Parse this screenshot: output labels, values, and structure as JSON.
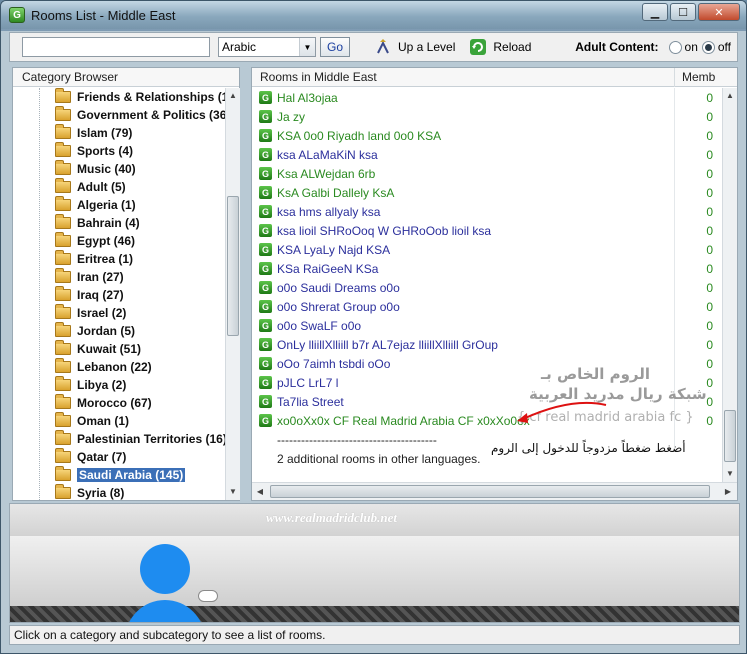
{
  "window": {
    "title": "Rooms List - Middle East",
    "app_icon_letter": "G"
  },
  "toolbar": {
    "search_value": "",
    "language": "Arabic",
    "go_label": "Go",
    "up_level_label": "Up a Level",
    "reload_label": "Reload",
    "adult_label": "Adult Content:",
    "adult_on_label": "on",
    "adult_off_label": "off",
    "adult_selected": "off"
  },
  "category_browser": {
    "header": "Category Browser",
    "items": [
      {
        "label": "Friends & Relationships (1"
      },
      {
        "label": "Government & Politics (36"
      },
      {
        "label": "Islam (79)"
      },
      {
        "label": "Sports (4)"
      },
      {
        "label": "Music (40)"
      },
      {
        "label": "Adult (5)"
      },
      {
        "label": "Algeria (1)"
      },
      {
        "label": "Bahrain (4)"
      },
      {
        "label": "Egypt (46)"
      },
      {
        "label": "Eritrea (1)"
      },
      {
        "label": "Iran (27)"
      },
      {
        "label": "Iraq (27)"
      },
      {
        "label": "Israel (2)"
      },
      {
        "label": "Jordan (5)"
      },
      {
        "label": "Kuwait (51)"
      },
      {
        "label": "Lebanon (22)"
      },
      {
        "label": "Libya (2)"
      },
      {
        "label": "Morocco (67)"
      },
      {
        "label": "Oman (1)"
      },
      {
        "label": "Palestinian Territories (16)"
      },
      {
        "label": "Qatar (7)"
      },
      {
        "label": "Saudi Arabia (145)",
        "selected": true
      },
      {
        "label": "Syria (8)"
      }
    ]
  },
  "rooms_panel": {
    "header": "Rooms in Middle East",
    "count_header": "Memb",
    "rooms": [
      {
        "name": "Hal Al3ojaa",
        "count": "0",
        "color": "green"
      },
      {
        "name": "Ja zy",
        "count": "0",
        "color": "green"
      },
      {
        "name": "KSA 0o0 Riyadh land 0o0 KSA",
        "count": "0",
        "color": "green"
      },
      {
        "name": "ksa ALaMaKiN ksa",
        "count": "0",
        "color": "blue"
      },
      {
        "name": "Ksa ALWejdan 6rb",
        "count": "0",
        "color": "green"
      },
      {
        "name": "KsA Galbi Dallely KsA",
        "count": "0",
        "color": "green"
      },
      {
        "name": "ksa hms allyaly ksa",
        "count": "0",
        "color": "blue"
      },
      {
        "name": "ksa lioil SHRoOoq W GHRoOob lioil ksa",
        "count": "0",
        "color": "blue"
      },
      {
        "name": "KSA LyaLy Najd KSA",
        "count": "0",
        "color": "blue"
      },
      {
        "name": "KSa RaiGeeN KSa",
        "count": "0",
        "color": "blue"
      },
      {
        "name": "o0o Saudi Dreams o0o",
        "count": "0",
        "color": "blue"
      },
      {
        "name": "o0o Shrerat Group o0o",
        "count": "0",
        "color": "blue"
      },
      {
        "name": "o0o SwaLF o0o",
        "count": "0",
        "color": "blue"
      },
      {
        "name": "OnLy lliillXlliill b7r AL7ejaz lliillXlliill GrOup",
        "count": "0",
        "color": "blue"
      },
      {
        "name": "oOo 7aimh tsbdi oOo",
        "count": "0",
        "color": "blue"
      },
      {
        "name": "pJLC LrL7 l",
        "count": "0",
        "color": "blue"
      },
      {
        "name": "Ta7lia Street",
        "count": "0",
        "color": "blue"
      },
      {
        "name": "xo0oXx0x CF Real Madrid Arabia CF x0xXo0ox",
        "count": "0",
        "color": "green"
      }
    ],
    "separator": "----------------------------------------",
    "additional": "2 additional rooms in other languages."
  },
  "annotation": {
    "arabic_line1": "الروم الخاص بـ",
    "arabic_line2": "شبكة ريال مدريد العربية",
    "latin_line": "{ cf real madrid arabia fc }",
    "hint": "أضغط ضغطاً مزدوجاً للدخول إلى الروم"
  },
  "bottom": {
    "watermark": "www.realmadridclub.net"
  },
  "status": {
    "text": "Click on a category and subcategory to see a list of rooms."
  }
}
